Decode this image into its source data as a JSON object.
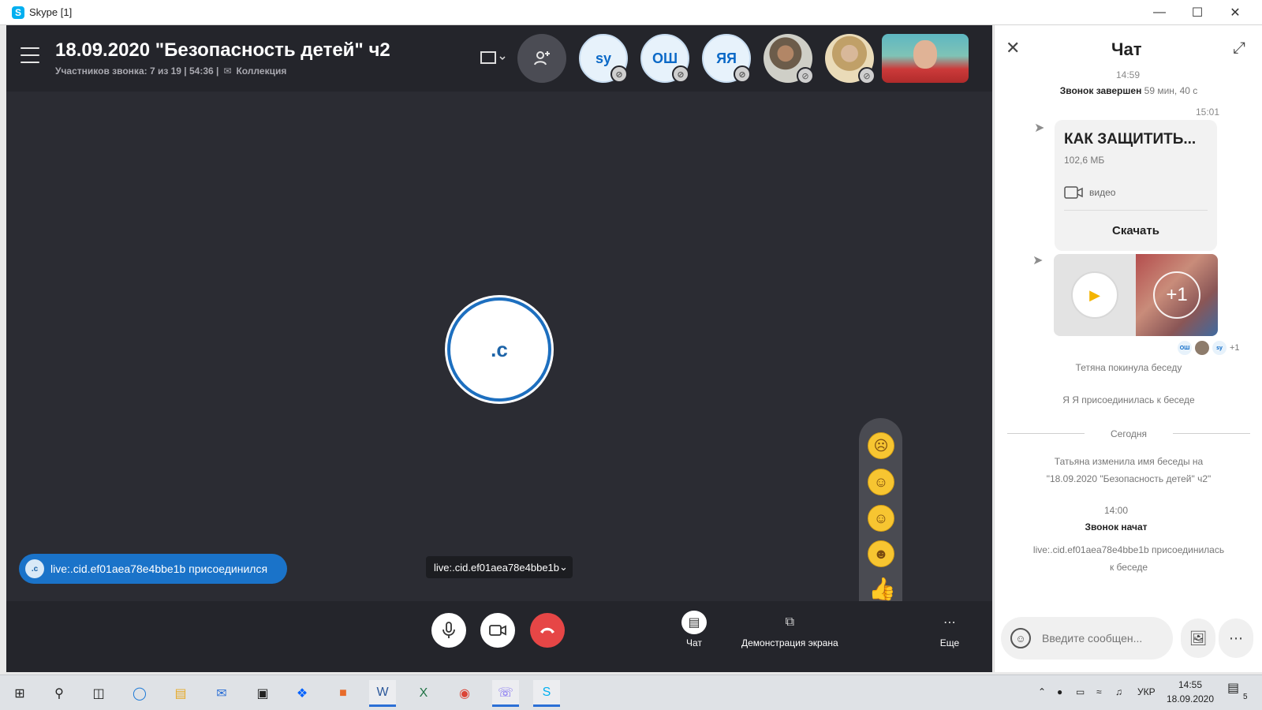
{
  "window": {
    "title": "Skype [1]"
  },
  "call": {
    "title": "18.09.2020 \"Безопасность детей\" ч2",
    "participants_info": "Участников звонка: 7 из 19 | 54:36 |",
    "collection_label": "Коллекция",
    "participants": [
      {
        "initials": "sy",
        "muted": true
      },
      {
        "initials": "ОШ",
        "muted": true
      },
      {
        "initials": "ЯЯ",
        "muted": true
      }
    ],
    "center_avatar": ".c",
    "joined_toast": "live:.cid.ef01aea78e4bbe1b присоединился",
    "toast_avatar": ".c",
    "source_selector": "live:.cid.ef01aea78e4bbe1b",
    "controls": {
      "chat_label": "Чат",
      "screen_share_label": "Демонстрация экрана",
      "more_label": "Еще"
    }
  },
  "chat": {
    "title": "Чат",
    "ts_top": "14:59",
    "call_ended_bold": "Звонок завершен",
    "call_ended_duration": "59 мин, 40 с",
    "ts_file": "15:01",
    "file": {
      "name": "КАК ЗАЩИТИТЬ...",
      "size": "102,6 МБ",
      "type": "видео",
      "download": "Скачать"
    },
    "media_more": "+1",
    "readers": {
      "r1": "ОШ",
      "r2": "sy",
      "extra": "+1"
    },
    "sys_left": "Тетяна покинула беседу",
    "sys_joined": "Я Я присоединилась к беседе",
    "today": "Сегодня",
    "rename_line1": "Татьяна изменила имя беседы на",
    "rename_line2": "\"18.09.2020 \"Безопасность детей\" ч2\"",
    "ts_call_start": "14:00",
    "call_started": "Звонок начат",
    "live_joined_line1": "live:.cid.ef01aea78e4bbe1b присоединилась",
    "live_joined_line2": "к беседе",
    "input_placeholder": "Введите сообщен..."
  },
  "taskbar": {
    "lang": "УКР",
    "time": "14:55",
    "date": "18.09.2020",
    "notifications": "5"
  }
}
